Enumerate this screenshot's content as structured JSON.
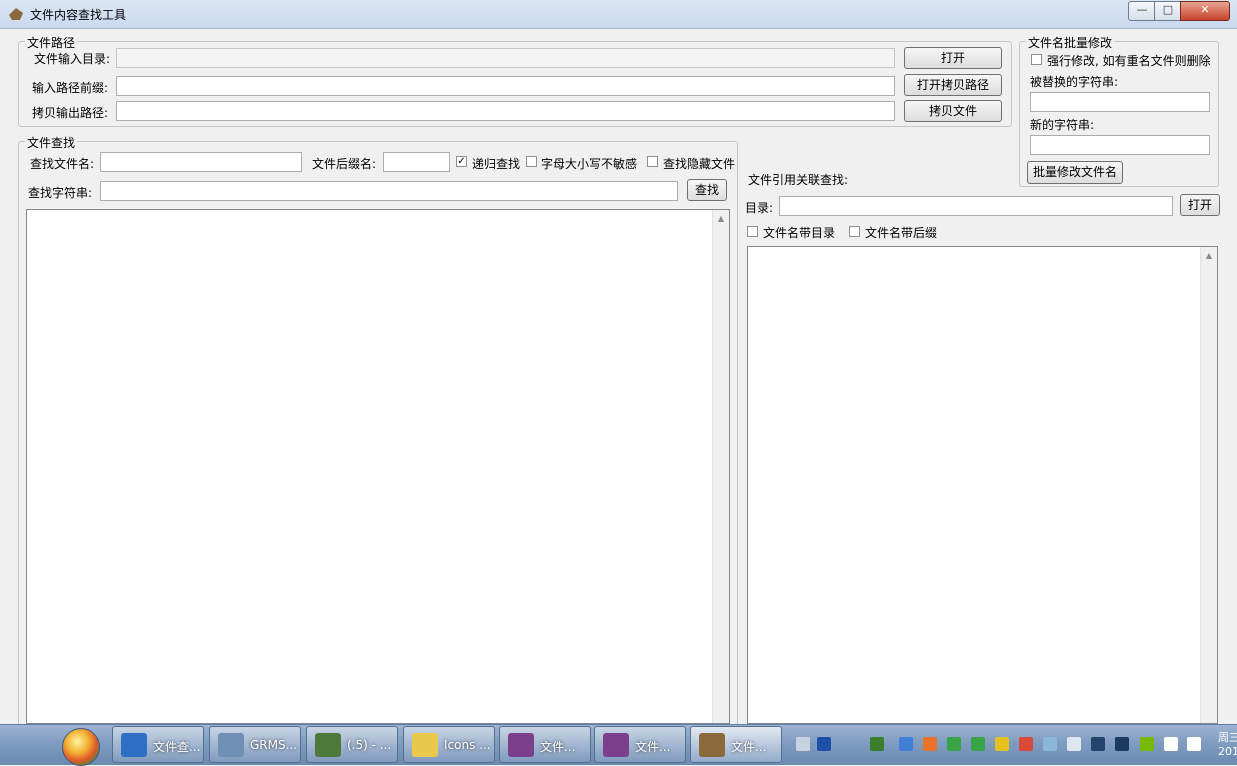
{
  "window": {
    "title": "文件内容查找工具",
    "minimize_symbol": "—",
    "maximize_symbol": "□",
    "close_symbol": "✕"
  },
  "path_group": {
    "legend": "文件路径",
    "input_dir_label": "文件输入目录:",
    "input_dir_value": "",
    "prefix_label": "输入路径前缀:",
    "prefix_value": "",
    "copy_out_label": "拷贝输出路径:",
    "copy_out_value": "",
    "open_button": "打开",
    "open_copy_path_button": "打开拷贝路径",
    "copy_files_button": "拷贝文件"
  },
  "search_group": {
    "legend": "文件查找",
    "filename_label": "查找文件名:",
    "filename_value": "",
    "ext_label": "文件后缀名:",
    "ext_value": "",
    "recursive_label": "递归查找",
    "recursive_checked": "✓",
    "case_label": "字母大小写不敏感",
    "hidden_label": "查找隐藏文件",
    "string_label": "查找字符串:",
    "string_value": "",
    "search_button": "查找",
    "scroll_up": "▲"
  },
  "rename_group": {
    "legend": "文件名批量修改",
    "force_label": "强行修改, 如有重名文件则删除",
    "replaced_label": "被替换的字符串:",
    "replaced_value": "",
    "new_label": "新的字符串:",
    "new_value": "",
    "rename_button": "批量修改文件名"
  },
  "reference_group": {
    "title": "文件引用关联查找:",
    "dir_label": "目录:",
    "dir_value": "",
    "open_button": "打开",
    "with_dir_label": "文件名带目录",
    "with_ext_label": "文件名带后缀",
    "scroll_up": "▲"
  },
  "taskbar": {
    "items": [
      {
        "label": "文件查...",
        "icon": "internet-explorer-icon",
        "color": "#2d6fc4"
      },
      {
        "label": "GRMS...",
        "icon": "media-player-icon",
        "color": "#6f8fb5"
      },
      {
        "label": "(.5) - ...",
        "icon": "editor-icon",
        "color": "#4d7a3a"
      },
      {
        "label": "Icons ...",
        "icon": "folder-icon",
        "color": "#e9c84b"
      },
      {
        "label": "文件...",
        "icon": "winrar-icon",
        "color": "#7b3f8c"
      },
      {
        "label": "文件...",
        "icon": "winrar-icon",
        "color": "#7b3f8c"
      },
      {
        "label": "文件...",
        "icon": "app-icon",
        "color": "#8a6a3a"
      }
    ],
    "clock_line1": "周三",
    "clock_line2": "201"
  },
  "tray_icons": [
    {
      "name": "keyboard-icon",
      "color": "#c8d3e0"
    },
    {
      "name": "help-icon",
      "color": "#1d4fa8"
    },
    {
      "name": "usb-icon",
      "color": "#3a7d2c"
    },
    {
      "name": "app-tray-icon",
      "color": "#3f7fd6"
    },
    {
      "name": "download-icon",
      "color": "#e8742a"
    },
    {
      "name": "update-icon",
      "color": "#3aa548"
    },
    {
      "name": "shield-icon",
      "color": "#3aa548"
    },
    {
      "name": "plus-icon",
      "color": "#e4c11e"
    },
    {
      "name": "security-icon",
      "color": "#d94a3a"
    },
    {
      "name": "check-icon",
      "color": "#8bb6d9"
    },
    {
      "name": "clipboard-icon",
      "color": "#dfe6ee"
    },
    {
      "name": "monitor-icon",
      "color": "#24446e"
    },
    {
      "name": "network-icon",
      "color": "#1c3b62"
    },
    {
      "name": "nvidia-icon",
      "color": "#76b900"
    },
    {
      "name": "signal-icon",
      "color": "#ffffff"
    },
    {
      "name": "volume-icon",
      "color": "#ffffff"
    }
  ]
}
